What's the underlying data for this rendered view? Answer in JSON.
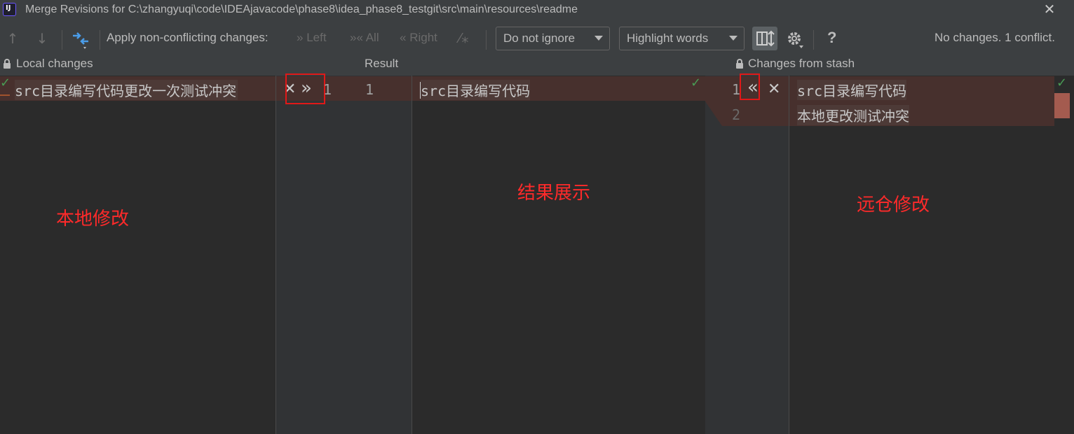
{
  "window": {
    "title": "Merge Revisions for C:\\zhangyuqi\\code\\IDEAjavacode\\phase8\\idea_phase8_testgit\\src\\main\\resources\\readme",
    "app_icon_text": "IJ"
  },
  "toolbar": {
    "apply_label": "Apply non-conflicting changes:",
    "left_label": "Left",
    "all_label": "All",
    "right_label": "Right",
    "ignore_select": "Do not ignore",
    "highlight_select": "Highlight words",
    "status": "No changes. 1 conflict.",
    "help_label": "?"
  },
  "panels": {
    "left_title": "Local changes",
    "center_title": "Result",
    "right_title": "Changes from stash"
  },
  "left_pane": {
    "lines": [
      "src目录编写代码更改一次测试冲突"
    ]
  },
  "center_pane": {
    "left_line_numbers": [
      "1"
    ],
    "result_line_numbers": [
      "1"
    ],
    "lines": [
      "src目录编写代码"
    ]
  },
  "right_pane": {
    "line_numbers": [
      "1",
      "2"
    ],
    "lines": [
      "src目录编写代码",
      "本地更改测试冲突"
    ]
  },
  "annotations": {
    "local_note": "本地修改",
    "result_note": "结果展示",
    "remote_note": "远仓修改"
  },
  "colors": {
    "background": "#2b2b2b",
    "conflict": "#47302d",
    "annotation": "#ff2a2a",
    "accept_check": "#499c54"
  }
}
